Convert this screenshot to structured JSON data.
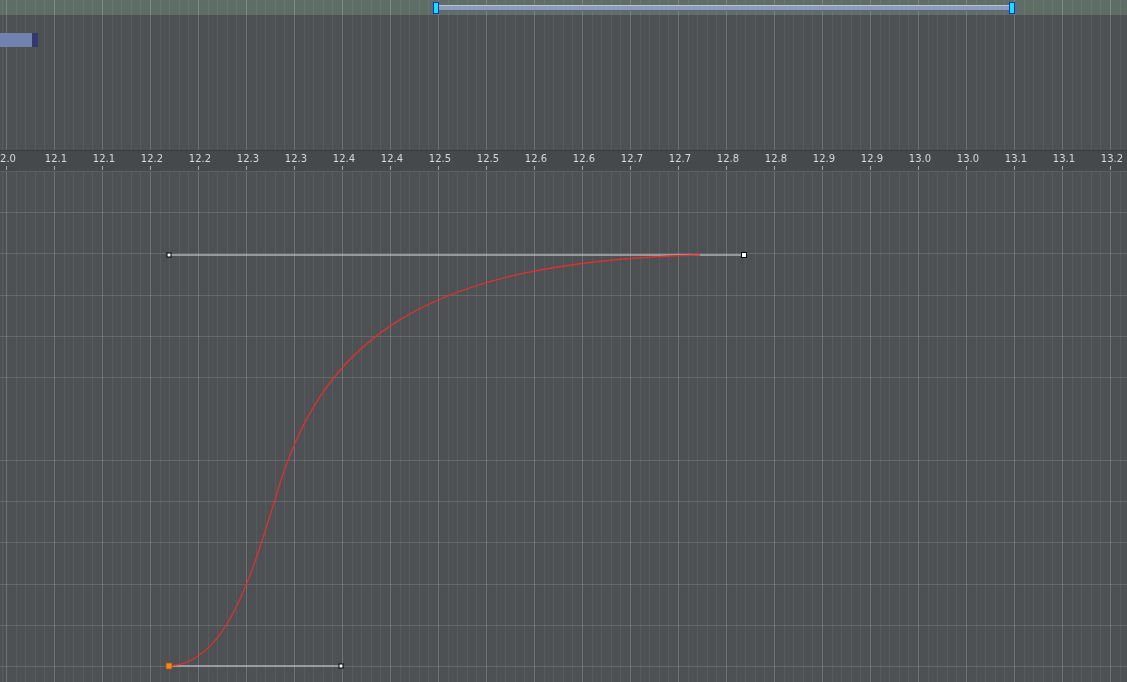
{
  "ruler": {
    "labels": [
      "2.0",
      "12.1",
      "12.1",
      "12.2",
      "12.2",
      "12.3",
      "12.3",
      "12.4",
      "12.4",
      "12.5",
      "12.5",
      "12.6",
      "12.6",
      "12.7",
      "12.7",
      "12.8",
      "12.8",
      "12.9",
      "12.9",
      "13.0",
      "13.0",
      "13.1",
      "13.1",
      "13.2"
    ]
  }
}
